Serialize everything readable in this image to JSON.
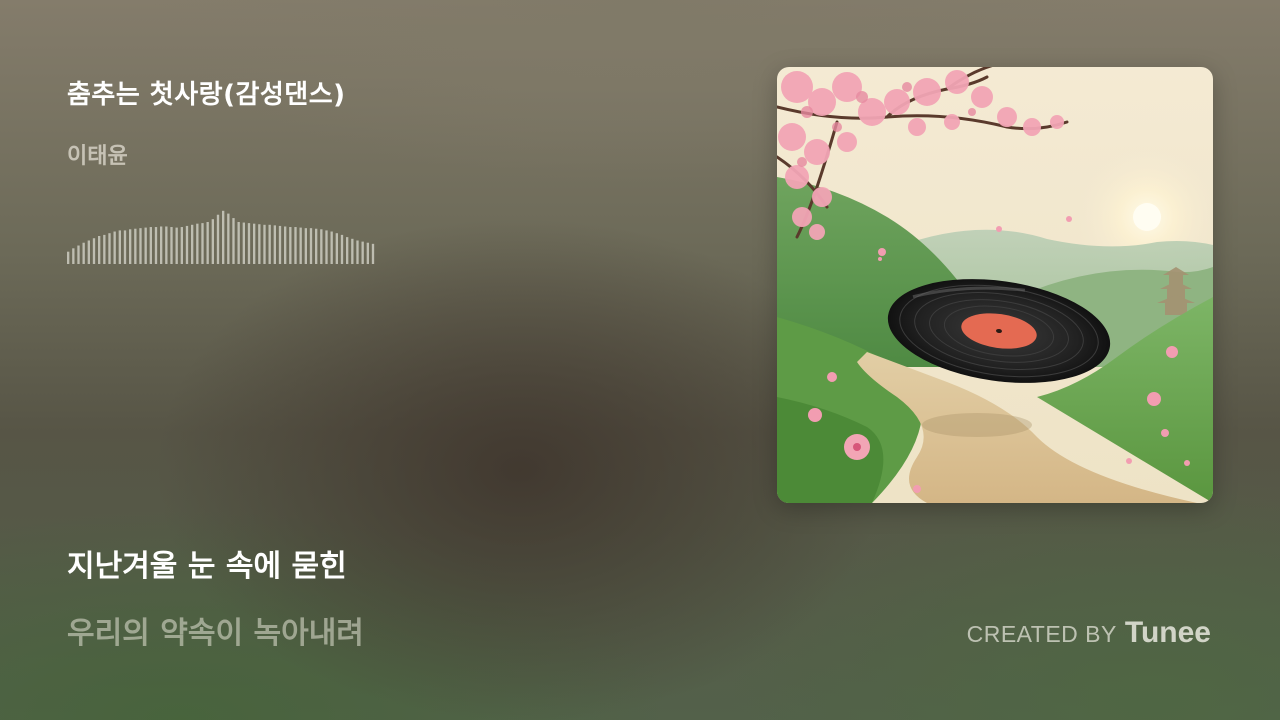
{
  "track": {
    "title": "춤추는 첫사랑(감성댄스)",
    "artist": "이태윤"
  },
  "lyrics": {
    "current_line": "지난겨울 눈 속에 묻힌",
    "next_line": "우리의 약속이 녹아내려"
  },
  "credit": {
    "prefix": "CREATED BY",
    "brand": "Tunee"
  },
  "waveform": {
    "levels": [
      0.22,
      0.28,
      0.33,
      0.38,
      0.42,
      0.46,
      0.5,
      0.52,
      0.55,
      0.58,
      0.6,
      0.6,
      0.62,
      0.63,
      0.64,
      0.65,
      0.66,
      0.66,
      0.67,
      0.67,
      0.66,
      0.65,
      0.66,
      0.68,
      0.7,
      0.72,
      0.73,
      0.75,
      0.8,
      0.88,
      0.95,
      0.9,
      0.82,
      0.75,
      0.74,
      0.73,
      0.72,
      0.71,
      0.7,
      0.7,
      0.69,
      0.68,
      0.67,
      0.66,
      0.66,
      0.65,
      0.64,
      0.64,
      0.63,
      0.62,
      0.6,
      0.58,
      0.55,
      0.52,
      0.48,
      0.45,
      0.42,
      0.4,
      0.38,
      0.36
    ],
    "color": "#d9d9cf"
  },
  "cover_art": {
    "description_icon": "vinyl-record-icon"
  },
  "colors": {
    "title": "#ffffff",
    "artist": "#e1ded2",
    "lyric_next": "#d2d4c4",
    "cover_sky": "#f1e7cf",
    "cover_hill": "#7fb266",
    "cover_path": "#d9bf92",
    "blossom": "#f2a5b5",
    "record_label": "#e46a52"
  }
}
